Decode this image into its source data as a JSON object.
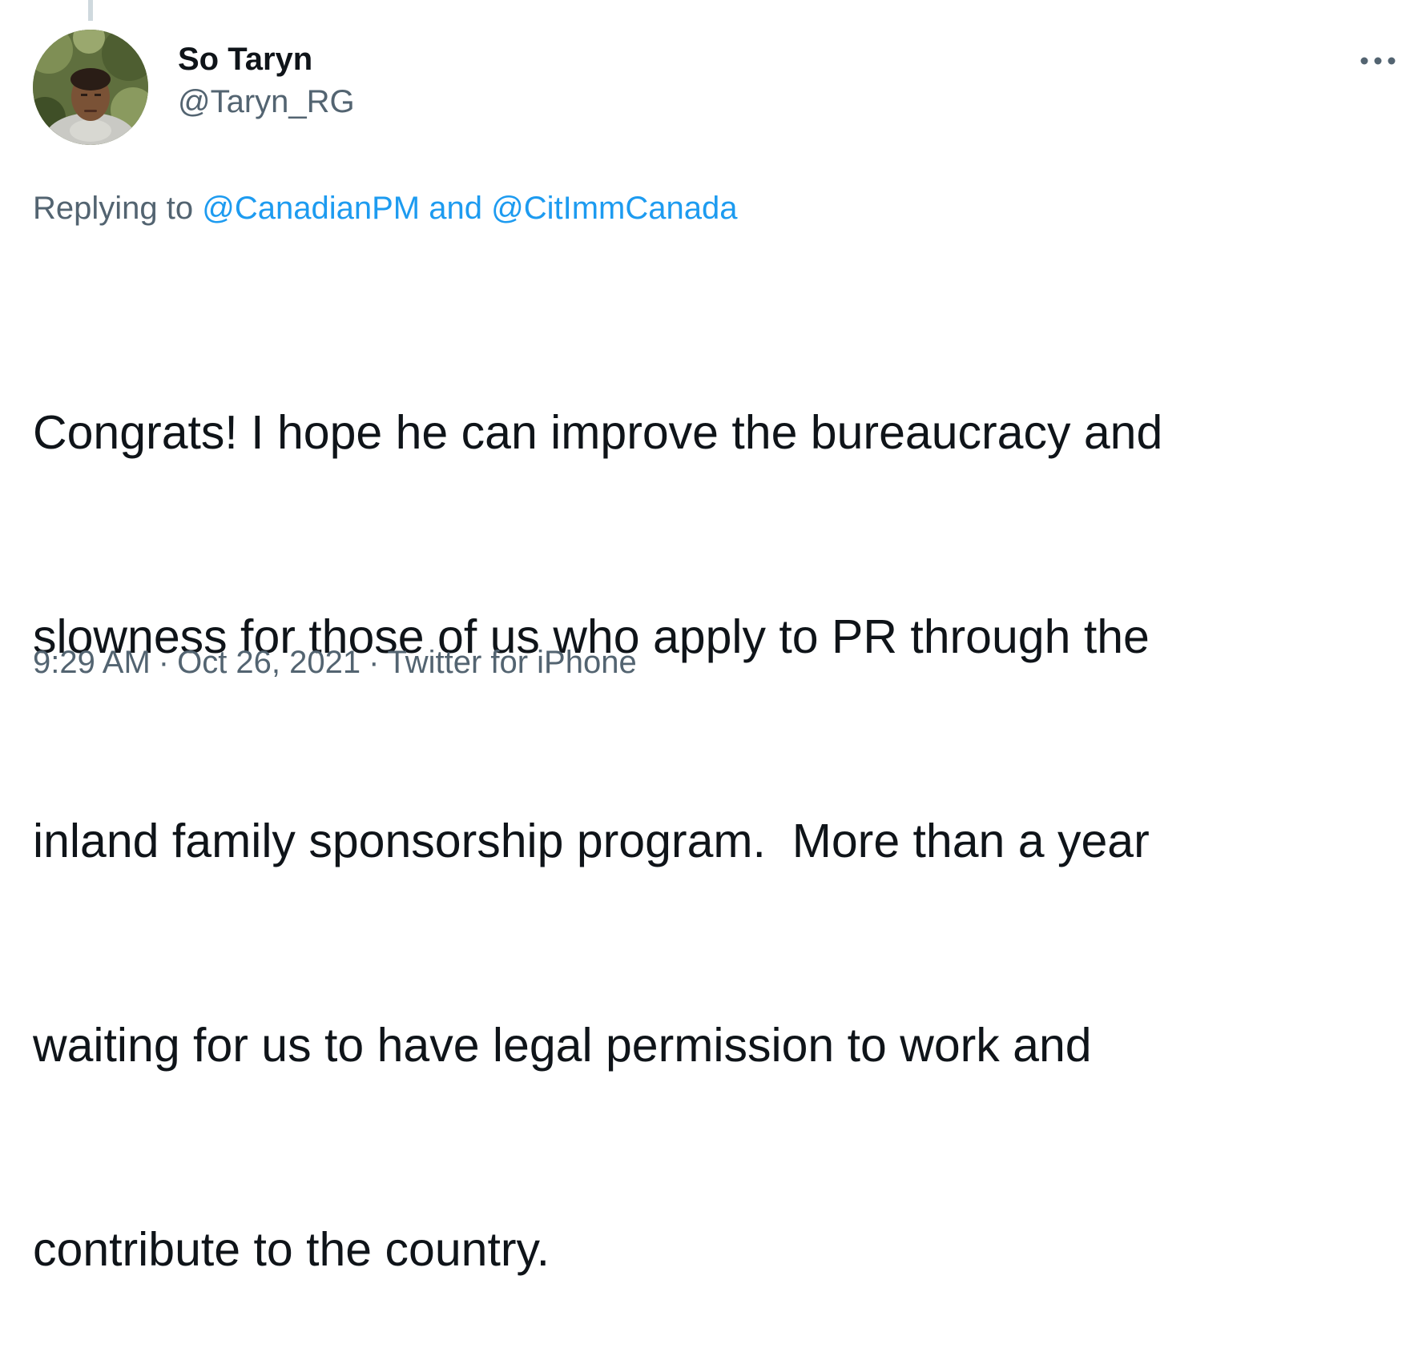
{
  "author": {
    "display_name": "So Taryn",
    "handle": "@Taryn_RG"
  },
  "icons": {
    "more": "more-horizontal-icon",
    "avatar": "profile-avatar"
  },
  "reply": {
    "prefix": "Replying to",
    "mention_1": "@CanadianPM",
    "conjunction": "and",
    "mention_2": "@CitImmCanada"
  },
  "tweet": {
    "lines": [
      "Congrats! I hope he can improve the bureaucracy and",
      "slowness for those of us who apply to PR through the",
      "inland family sponsorship program.  More than a year",
      "waiting for us to have legal permission to work and",
      "contribute to the country."
    ]
  },
  "meta": {
    "time": "9:29 AM",
    "separator": "·",
    "date": "Oct 26, 2021",
    "source": "Twitter for iPhone"
  },
  "colors": {
    "text_primary": "#0f1419",
    "text_secondary": "#536471",
    "link": "#1d9bf0"
  }
}
